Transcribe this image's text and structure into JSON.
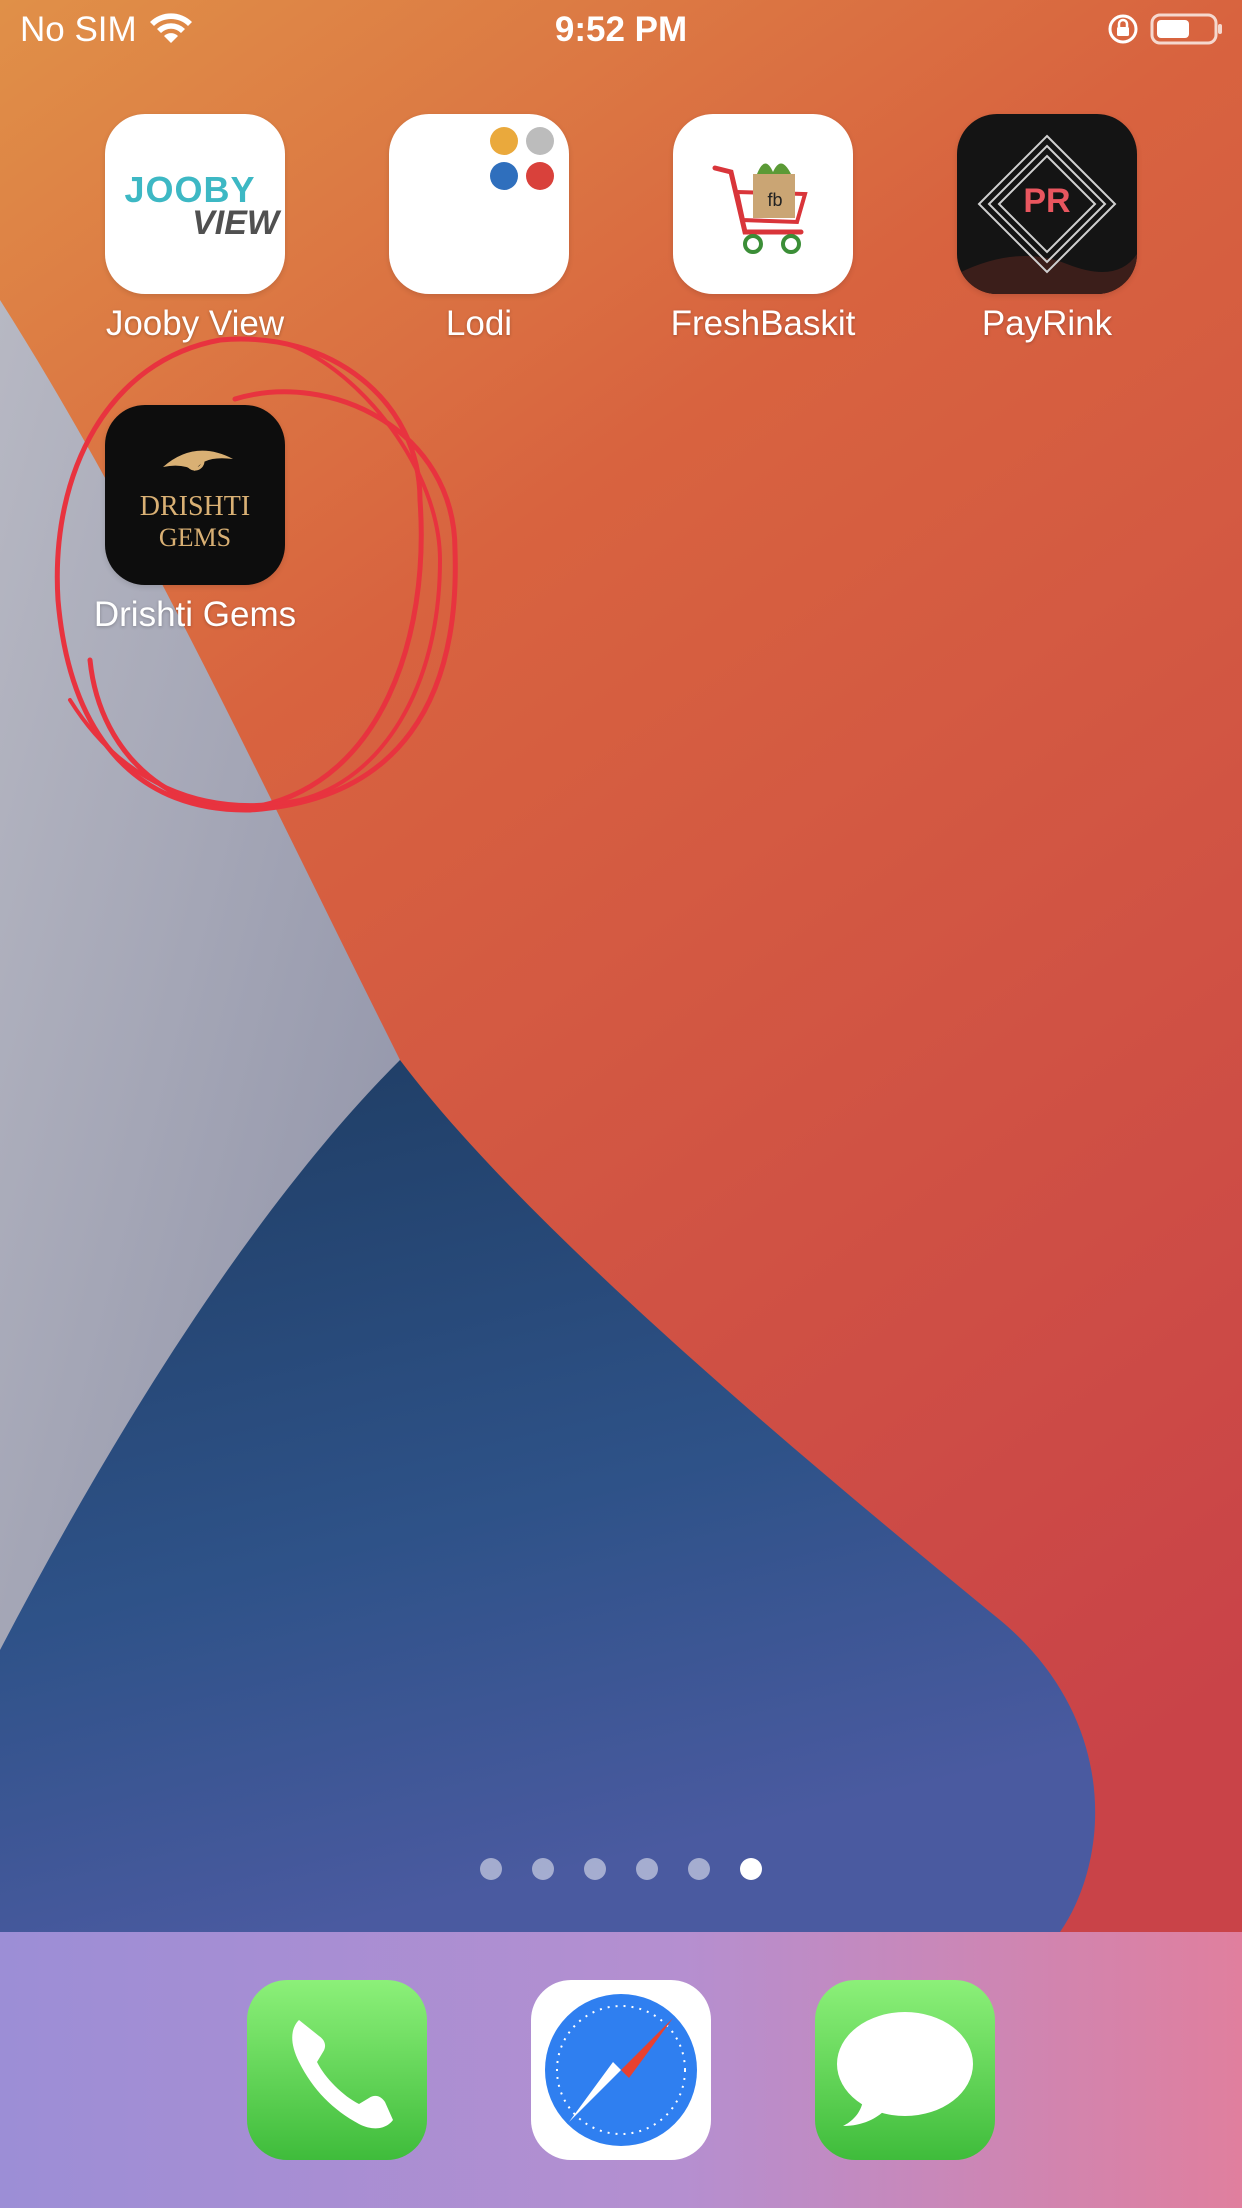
{
  "status_bar": {
    "carrier": "No SIM",
    "time": "9:52 PM",
    "wifi_icon": "wifi-icon",
    "rotation_lock_icon": "rotation-lock-icon",
    "battery_icon": "battery-icon"
  },
  "apps": [
    {
      "label": "Jooby View",
      "logo_top": "JOOBY",
      "logo_bottom": "VIEW"
    },
    {
      "label": "Lodi"
    },
    {
      "label": "FreshBaskit",
      "logo_text": "fb"
    },
    {
      "label": "PayRink",
      "logo_text": "PR"
    },
    {
      "label": "Drishti Gems",
      "logo_line1": "DRISHTI",
      "logo_line2": "GEMS"
    }
  ],
  "page_dots": {
    "count": 6,
    "active_index": 5
  },
  "dock": [
    {
      "icon": "phone-icon"
    },
    {
      "icon": "safari-compass-icon"
    },
    {
      "icon": "messages-icon"
    }
  ],
  "colors": {
    "annotation": "#e8333f",
    "jooby_teal": "#3db8c4",
    "jooby_gray": "#505050",
    "payrink_red": "#e9565f",
    "drishti_gold": "#d9b074",
    "phone_green": "#5ed84d",
    "safari_blue": "#2f7ff0"
  }
}
